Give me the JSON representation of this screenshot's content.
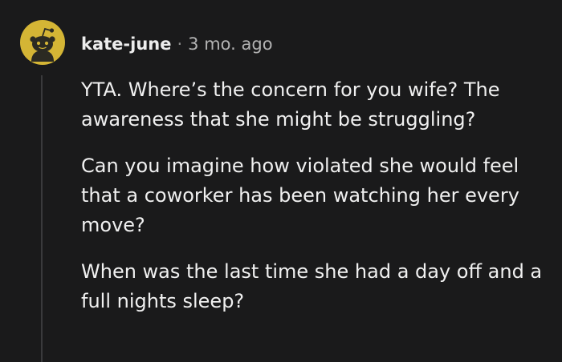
{
  "comment": {
    "author": "kate-june",
    "separator": "·",
    "timestamp": "3 mo. ago",
    "avatar_icon": "snoo-avatar-icon",
    "avatar_color": "#d4b535",
    "paragraphs": [
      "YTA. Where’s the concern for you wife? The awareness that she might be struggling?",
      "Can you imagine how violated she would feel that a coworker has been watching her every move?",
      "When was the last time she had a day off and a full nights sleep?"
    ]
  }
}
